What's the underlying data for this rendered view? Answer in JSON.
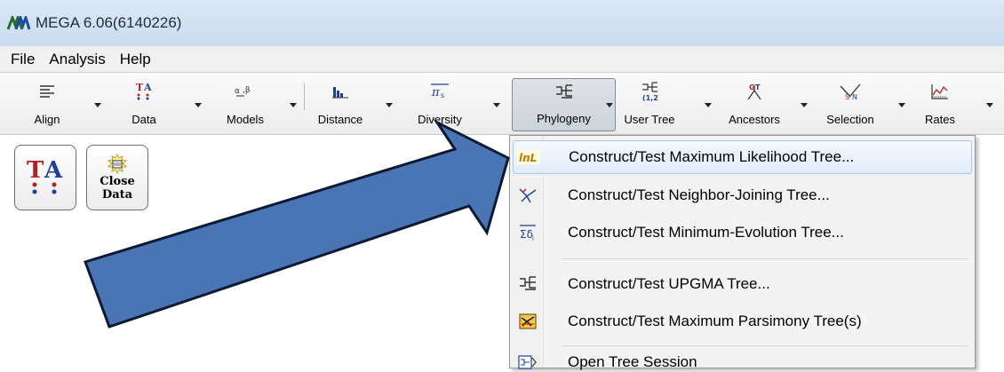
{
  "window": {
    "title": "MEGA 6.06(6140226)"
  },
  "menubar": {
    "items": [
      "File",
      "Analysis",
      "Help"
    ]
  },
  "toolbar": {
    "align": "Align",
    "data": "Data",
    "models": "Models",
    "distance": "Distance",
    "diversity": "Diversity",
    "phylogeny": "Phylogeny",
    "user_tree": "User Tree",
    "ancestors": "Ancestors",
    "selection": "Selection",
    "rates": "Rates"
  },
  "panel": {
    "ta_label": "TA",
    "close_data": "Close\nData"
  },
  "phylogeny_menu": {
    "items": [
      {
        "icon": "lnL",
        "label": "Construct/Test Maximum Likelihood Tree..."
      },
      {
        "icon": "neighbor-joining-icon",
        "label": "Construct/Test Neighbor-Joining Tree..."
      },
      {
        "icon": "minimum-evolution-icon",
        "label": "Construct/Test Minimum-Evolution Tree..."
      },
      {
        "icon": "upgma-icon",
        "label": "Construct/Test UPGMA Tree..."
      },
      {
        "icon": "parsimony-icon",
        "label": "Construct/Test Maximum Parsimony Tree(s)"
      },
      {
        "icon": "tree-session-icon",
        "label": "Open Tree Session"
      }
    ]
  },
  "colors": {
    "arrow_fill": "#4a75b4",
    "arrow_stroke": "#0b1a33",
    "highlight": "#e1ecfa"
  }
}
